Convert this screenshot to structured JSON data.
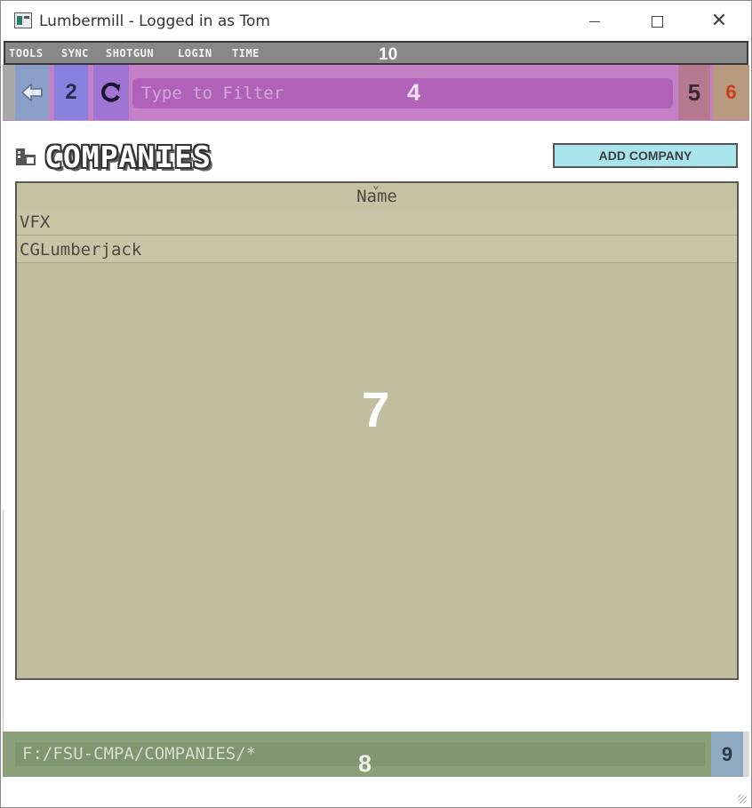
{
  "window": {
    "title": "Lumbermill - Logged in as Tom"
  },
  "menu": {
    "items": [
      "TOOLS",
      "SYNC",
      "SHOTGUN",
      "LOGIN",
      "TIME"
    ],
    "badge": "10"
  },
  "toolbar": {
    "back_icon": "back-arrow-icon",
    "button2_label": "2",
    "refresh_icon": "refresh-icon",
    "filter_placeholder": "Type to Filter",
    "filter_badge": "4",
    "button5_label": "5",
    "button6_label": "6"
  },
  "page": {
    "title": "COMPANIES",
    "add_button_label": "ADD COMPANY"
  },
  "table": {
    "column_header": "Name",
    "rows": [
      "VFX",
      "CGLumberjack"
    ],
    "badge": "7"
  },
  "pathbar": {
    "path": "F:/FSU-CMPA/COMPANIES/*",
    "badge": "8",
    "button9_label": "9"
  },
  "colors": {
    "toolbar_bg": "#c380c6",
    "table_bg": "#c2bfa0",
    "pathbar_bg": "#89a07a",
    "add_button_bg": "#a8e4ec"
  }
}
